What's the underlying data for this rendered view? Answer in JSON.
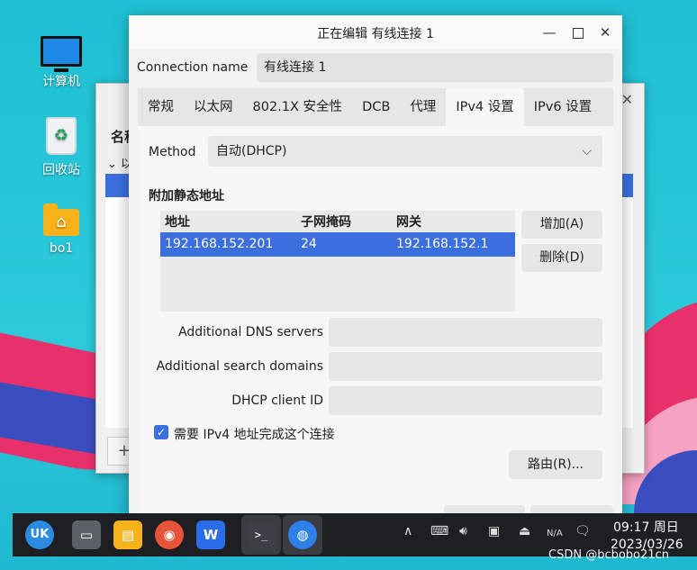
{
  "desktop": {
    "icons": [
      {
        "label": "计算机",
        "icon": "computer-icon"
      },
      {
        "label": "回收站",
        "icon": "trash-icon"
      },
      {
        "label": "bo1",
        "icon": "home-folder-icon"
      }
    ]
  },
  "background_window": {
    "name_header": "名称",
    "row_label": "以"
  },
  "dialog": {
    "title": "正在编辑 有线连接 1",
    "connection_name_label": "Connection name",
    "connection_name_value": "有线连接 1",
    "tabs": [
      "常规",
      "以太网",
      "802.1X 安全性",
      "DCB",
      "代理",
      "IPv4 设置",
      "IPv6 设置"
    ],
    "active_tab": "IPv4 设置",
    "method_label": "Method",
    "method_value": "自动(DHCP)",
    "static_section_title": "附加静态地址",
    "table_headers": [
      "地址",
      "子网掩码",
      "网关"
    ],
    "addresses": [
      {
        "address": "192.168.152.201",
        "netmask": "24",
        "gateway": "192.168.152.1"
      }
    ],
    "add_button": "增加(A)",
    "delete_button": "删除(D)",
    "dns_label": "Additional DNS servers",
    "dns_value": "",
    "search_label": "Additional search domains",
    "search_value": "",
    "dhcp_id_label": "DHCP client ID",
    "dhcp_id_value": "",
    "require_ipv4_label": "需要 IPv4 地址完成这个连接",
    "require_ipv4_checked": true,
    "routes_button": "路由(R)..."
  },
  "taskbar": {
    "time": "09:17 周日",
    "date": "2023/03/26",
    "tray_na": "N/A"
  },
  "watermark": "CSDN @bcbobo21cn",
  "colors": {
    "selection": "#3b6fe0",
    "desktop": "#22c3d4",
    "taskbar": "#1d1f22"
  }
}
